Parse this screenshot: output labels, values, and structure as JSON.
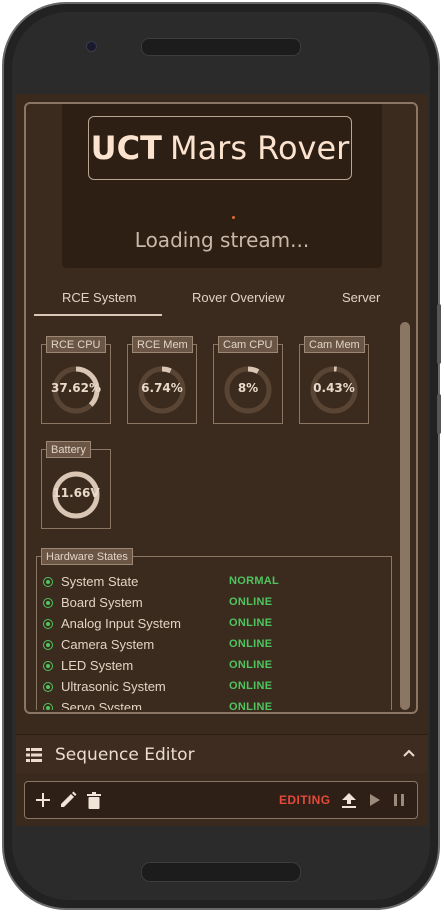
{
  "stream": {
    "title_bold": "UCT",
    "title_rest": "Mars Rover",
    "loading_text": "Loading stream..."
  },
  "tabs": [
    {
      "label": "RCE System",
      "active": true
    },
    {
      "label": "Rover Overview",
      "active": false
    },
    {
      "label": "Server",
      "active": false
    }
  ],
  "gauges": [
    {
      "label": "RCE CPU",
      "value_text": "37.62%",
      "fraction": 0.3762
    },
    {
      "label": "RCE Mem",
      "value_text": "6.74%",
      "fraction": 0.0674
    },
    {
      "label": "Cam CPU",
      "value_text": "8%",
      "fraction": 0.08
    },
    {
      "label": "Cam Mem",
      "value_text": "0.43%",
      "fraction": 0.0043
    },
    {
      "label": "Battery",
      "value_text": "11.66V",
      "fraction": 1.0
    }
  ],
  "hardware": {
    "title": "Hardware States",
    "rows": [
      {
        "name": "System State",
        "status": "NORMAL"
      },
      {
        "name": "Board System",
        "status": "ONLINE"
      },
      {
        "name": "Analog Input System",
        "status": "ONLINE"
      },
      {
        "name": "Camera System",
        "status": "ONLINE"
      },
      {
        "name": "LED System",
        "status": "ONLINE"
      },
      {
        "name": "Ultrasonic System",
        "status": "ONLINE"
      },
      {
        "name": "Servo System",
        "status": "ONLINE"
      }
    ]
  },
  "sequence_editor": {
    "title": "Sequence Editor",
    "mode_label": "EDITING"
  },
  "colors": {
    "background": "#3a2a1d",
    "accent_text": "#fbe3cf",
    "status_ok": "#4fc45f",
    "editing": "#e24a3a"
  }
}
